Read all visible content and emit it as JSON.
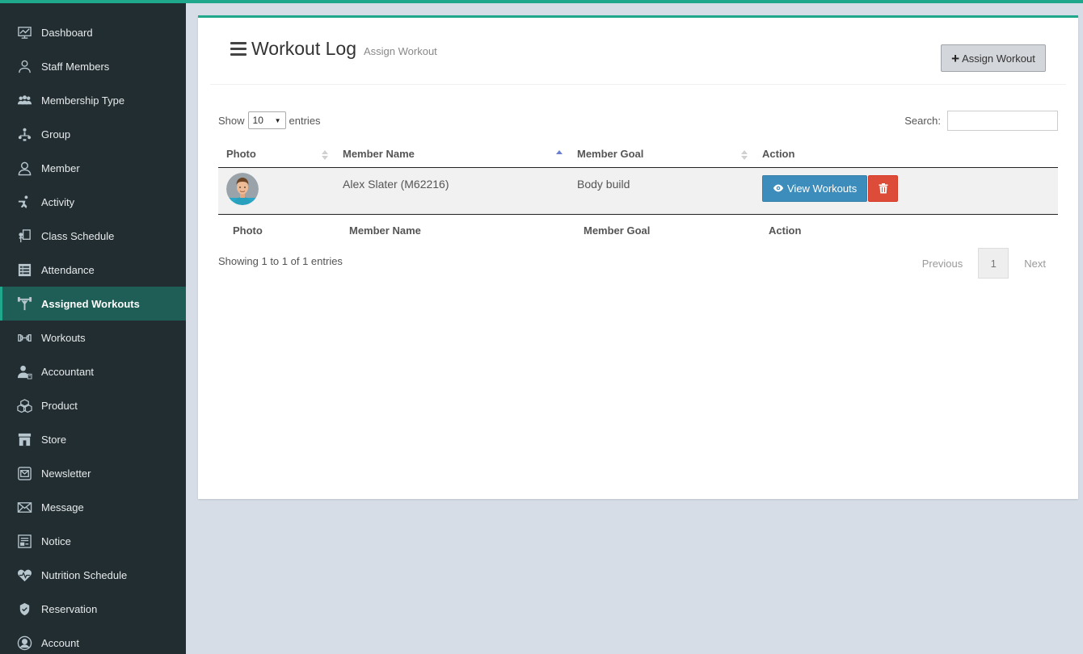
{
  "sidebar": {
    "items": [
      {
        "label": "Dashboard",
        "icon": "dashboard-icon"
      },
      {
        "label": "Staff Members",
        "icon": "staff-icon"
      },
      {
        "label": "Membership Type",
        "icon": "membership-icon"
      },
      {
        "label": "Group",
        "icon": "group-icon"
      },
      {
        "label": "Member",
        "icon": "member-icon"
      },
      {
        "label": "Activity",
        "icon": "activity-icon"
      },
      {
        "label": "Class Schedule",
        "icon": "class-schedule-icon"
      },
      {
        "label": "Attendance",
        "icon": "attendance-icon"
      },
      {
        "label": "Assigned Workouts",
        "icon": "assigned-workouts-icon",
        "active": true
      },
      {
        "label": "Workouts",
        "icon": "dumbbell-icon"
      },
      {
        "label": "Accountant",
        "icon": "accountant-icon"
      },
      {
        "label": "Product",
        "icon": "product-icon"
      },
      {
        "label": "Store",
        "icon": "store-icon"
      },
      {
        "label": "Newsletter",
        "icon": "newsletter-icon"
      },
      {
        "label": "Message",
        "icon": "message-icon"
      },
      {
        "label": "Notice",
        "icon": "notice-icon"
      },
      {
        "label": "Nutrition Schedule",
        "icon": "nutrition-icon"
      },
      {
        "label": "Reservation",
        "icon": "reservation-icon"
      },
      {
        "label": "Account",
        "icon": "account-icon"
      }
    ]
  },
  "header": {
    "title": "Workout Log",
    "subtitle": "Assign Workout",
    "assign_button": "Assign Workout"
  },
  "table_controls": {
    "show_label": "Show",
    "entries_value": "10",
    "entries_label": "entries",
    "search_label": "Search:",
    "search_value": ""
  },
  "table": {
    "columns": [
      "Photo",
      "Member Name",
      "Member Goal",
      "Action"
    ],
    "rows": [
      {
        "member_name": "Alex Slater (M62216)",
        "member_goal": "Body build",
        "view_button": "View Workouts"
      }
    ]
  },
  "footer": {
    "info": "Showing 1 to 1 of 1 entries",
    "previous": "Previous",
    "page": "1",
    "next": "Next"
  },
  "colors": {
    "accent": "#1fa88c",
    "sidebar_bg": "#222d32",
    "active_item_bg": "#1e5e56",
    "view_button": "#3c8dbc",
    "delete_button": "#dd4b39"
  }
}
